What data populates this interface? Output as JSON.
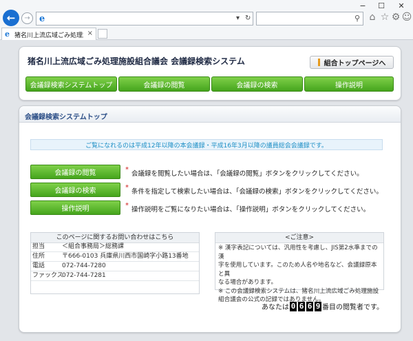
{
  "browser": {
    "tab_title": "猪名川上流広域ごみ処理施...",
    "tab_close": "×",
    "address_favicon": "e",
    "address_dropdown": "▾",
    "address_refresh": "↻",
    "search_icon": "⚲",
    "icons": [
      "home-icon",
      "star-icon",
      "gear-icon",
      "smiley-icon"
    ],
    "window_controls": [
      "−",
      "☐",
      "✕"
    ]
  },
  "header": {
    "site_title": "猪名川上流広域ごみ処理施設組合議会 会議録検索システム",
    "top_link": "組合トップページへ",
    "nav": [
      "会議録検索システムトップ",
      "会議録の閲覧",
      "会議録の検索",
      "操作説明"
    ]
  },
  "main": {
    "section_title": "会議録検索システムトップ",
    "notice": "ご覧になれるのは平成12年以降の本会議録・平成16年3月以降の議員総会会議録です。",
    "actions": [
      {
        "label": "会議録の閲覧",
        "desc": "会議録を閲覧したい場合は、「会議録の閲覧」ボタンをクリックしてください。"
      },
      {
        "label": "会議録の検索",
        "desc": "条件を指定して検索したい場合は、「会議録の検索」ボタンをクリックしてください。"
      },
      {
        "label": "操作説明",
        "desc": "操作説明をご覧になりたい場合は、「操作説明」ボタンをクリックしてください。"
      }
    ],
    "star": "*"
  },
  "contact": {
    "heading": "このページに関するお問い合わせはこちら",
    "rows": [
      {
        "k": "担当",
        "v": "＜組合事務局＞総務課"
      },
      {
        "k": "住所",
        "v": "〒666-0103 兵庫県川西市国崎字小路13番地"
      },
      {
        "k": "電話",
        "v": "072-744-7280"
      },
      {
        "k": "ファックス",
        "v": "072-744-7281"
      }
    ]
  },
  "caution": {
    "heading": "<ご注意>",
    "lines": [
      "※ 漢字表記については、汎用性を考慮し、JIS第2水準までの漢",
      "字を使用しています。このため人名や地名など、会議録原本と異",
      "なる場合があります。",
      "※ この会議録検索システムは、猪名川上流広域ごみ処理施設",
      "組合議会の公式の記録ではありません。"
    ]
  },
  "counter": {
    "prefix": "あなたは",
    "digits": [
      "0",
      "6",
      "6",
      "9"
    ],
    "suffix": "番目の閲覧者です。"
  }
}
